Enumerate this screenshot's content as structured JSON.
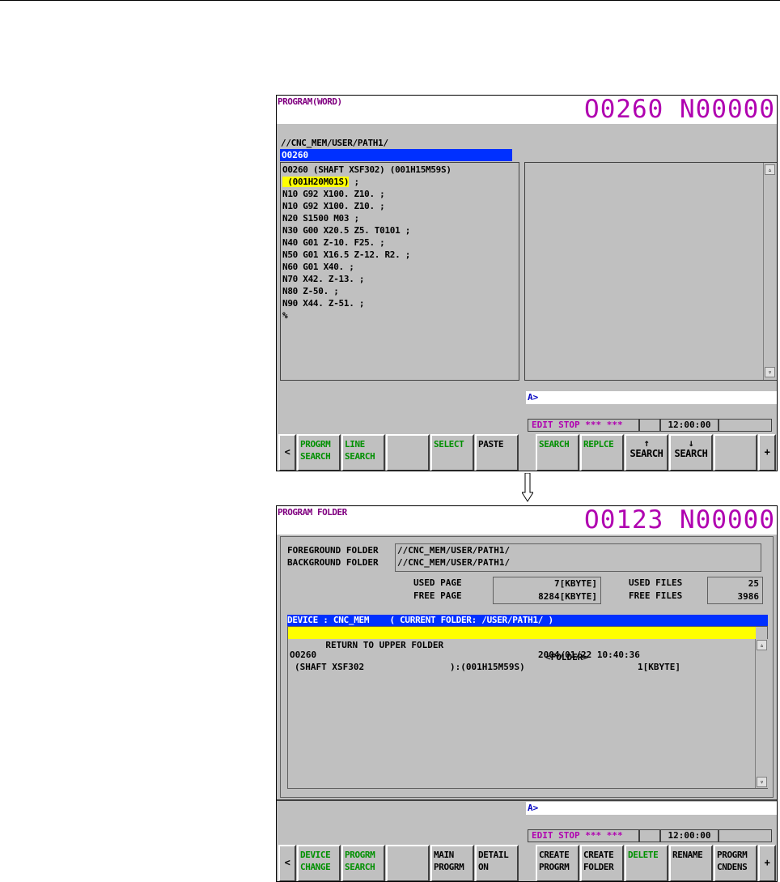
{
  "screen1": {
    "title": "PROGRAM(WORD)",
    "on_number": "O0260 N00000",
    "path": "//CNC_MEM/USER/PATH1/",
    "program_field": "O0260",
    "code_lines": [
      "O0260 (SHAFT XSF302) (001H15M59S)",
      " (001H20M01S)",
      "N10 G92 X100. Z10. ;",
      "N10 G92 X100. Z10. ;",
      "N20 S1500 M03 ;",
      "N30 G00 X20.5 Z5. T0101 ;",
      "N40 G01 Z-10. F25. ;",
      "N50 G01 X16.5 Z-12. R2. ;",
      "N60 G01 X40. ;",
      "N70 X42. Z-13. ;",
      "N80 Z-50. ;",
      "N90 X44. Z-51. ;",
      "%"
    ],
    "highlight_suffix": " ;",
    "input_prompt": "A>",
    "mode_status": "EDIT STOP *** ***",
    "time": "12:00:00",
    "softkeys": {
      "prev": "<",
      "k1": "PROGRM\nSEARCH",
      "k2": "LINE\nSEARCH",
      "k3": "",
      "k4": "SELECT",
      "k5": "PASTE",
      "k6": "SEARCH",
      "k7": "REPLCE",
      "k8": "↑\nSEARCH",
      "k9": "↓\nSEARCH",
      "k10": "",
      "next": "+"
    }
  },
  "screen2": {
    "title": "PROGRAM FOLDER",
    "on_number": "O0123 N00000",
    "foreground_label": "FOREGROUND FOLDER",
    "background_label": "BACKGROUND FOLDER",
    "foreground_value": "//CNC_MEM/USER/PATH1/",
    "background_value": "//CNC_MEM/USER/PATH1/",
    "used_page_label": "USED PAGE",
    "free_page_label": "FREE PAGE",
    "used_page_value": "7[KBYTE]",
    "free_page_value": "8284[KBYTE]",
    "used_files_label": "USED FILES",
    "free_files_label": "FREE FILES",
    "used_files_value": "25",
    "free_files_value": "3986",
    "list_header": "DEVICE : CNC_MEM    ( CURRENT FOLDER: /USER/PATH1/ )",
    "upper_folder_label": " RETURN TO UPPER FOLDER",
    "upper_folder_type": "<FOLDER>",
    "file_name": "O0260",
    "file_date": "2004/01/22 10:40:36",
    "file_comment": "(SHAFT XSF302                ):(001H15M59S)",
    "file_size": "1[KBYTE]",
    "input_prompt": "A>",
    "mode_status": "EDIT STOP *** ***",
    "time": "12:00:00",
    "softkeys": {
      "prev": "<",
      "k1": "DEVICE\nCHANGE",
      "k2": "PROGRM\nSEARCH",
      "k3": "",
      "k4": "MAIN\nPROGRM",
      "k5": "DETAIL\nON",
      "k6": "CREATE\nPROGRM",
      "k7": "CREATE\nFOLDER",
      "k8": "DELETE",
      "k9": "RENAME",
      "k10": "PROGRM\nCNDENS",
      "next": "+"
    }
  },
  "colors": {
    "screen_bg": "#c0c0c0",
    "selection_blue": "#0030ff",
    "highlight_yellow": "#ffff00",
    "on_number_magenta": "#b000b0",
    "softkey_green": "#009000"
  },
  "icons": {
    "scroll_up": "▵",
    "scroll_down": "▿",
    "transition_arrow": "down-arrow-icon"
  }
}
